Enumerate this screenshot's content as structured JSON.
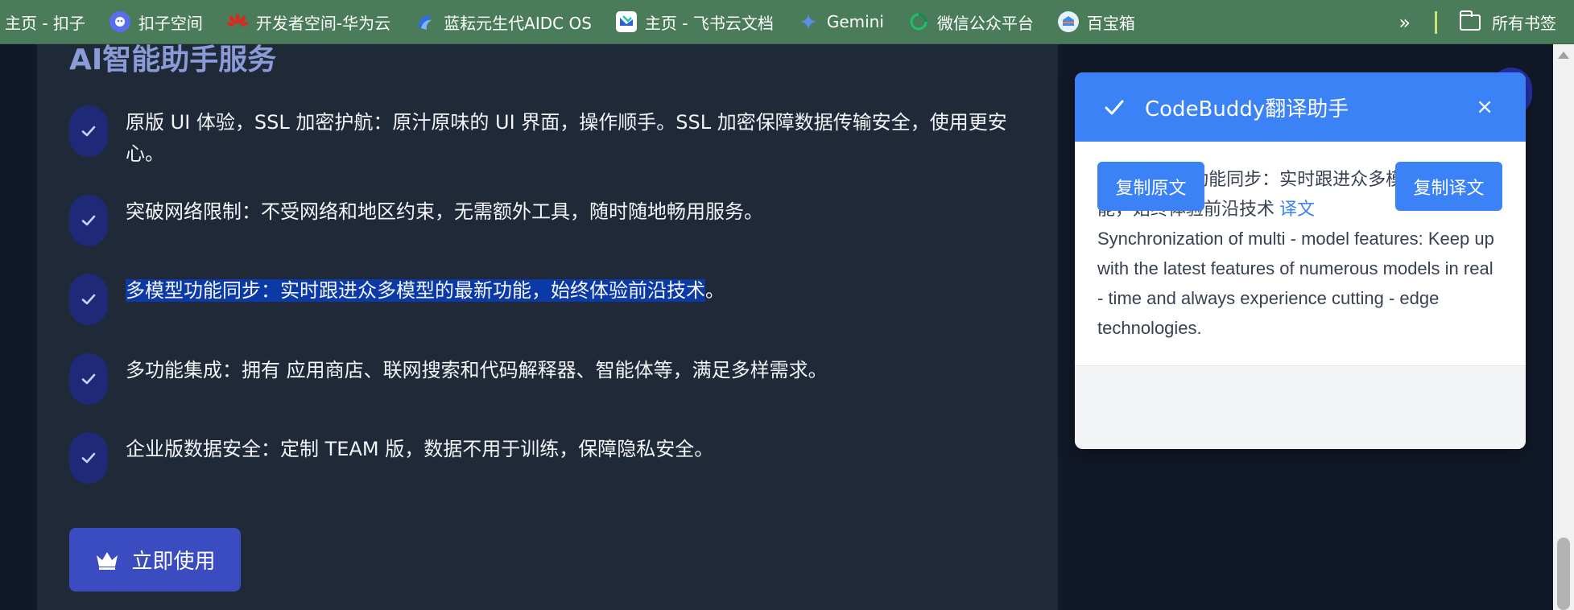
{
  "bookmarks": {
    "items": [
      {
        "label": "主页 - 扣子",
        "icon": "none"
      },
      {
        "label": "扣子空间",
        "icon": "coze-space-icon"
      },
      {
        "label": "开发者空间-华为云",
        "icon": "huawei-icon"
      },
      {
        "label": "蓝耘元生代AIDC OS",
        "icon": "lanyun-icon"
      },
      {
        "label": "主页 - 飞书云文档",
        "icon": "feishu-icon"
      },
      {
        "label": "Gemini",
        "icon": "gemini-icon"
      },
      {
        "label": "微信公众平台",
        "icon": "wechat-icon"
      },
      {
        "label": "百宝箱",
        "icon": "baibaoxiang-icon"
      }
    ],
    "more": "»",
    "folder_label": "所有书签"
  },
  "section": {
    "title": "AI智能助手服务",
    "features": [
      {
        "text": "原版 UI 体验，SSL 加密护航：原汁原味的 UI 界面，操作顺手。SSL 加密保障数据传输安全，使用更安心。"
      },
      {
        "text": "突破网络限制：不受网络和地区约束，无需额外工具，随时随地畅用服务。"
      },
      {
        "selected": "多模型功能同步：实时跟进众多模型的最新功能，始终体验前沿技术",
        "rest": "。"
      },
      {
        "text": "多功能集成：拥有 应用商店、联网搜索和代码解释器、智能体等，满足多样需求。"
      },
      {
        "text": "企业版数据安全：定制 TEAM 版，数据不用于训练，保障隐私安全。"
      }
    ],
    "use_button": "立即使用"
  },
  "popup": {
    "title": "CodeBuddy翻译助手",
    "close": "×",
    "original_label": "原文",
    "original_text": "多模型功能同步：实时跟进众多模型的最新功能，始终体验前沿技术",
    "translation_label": "译文",
    "translation_text": "Synchronization of multi - model features: Keep up with the latest features of numerous models in real - time and always experience cutting - edge technologies.",
    "copy_original": "复制原文",
    "copy_translation": "复制译文"
  },
  "colors": {
    "bookmark_bar": "#4a7c59",
    "accent": "#3b82f6",
    "selection": "#0b3aa6"
  }
}
